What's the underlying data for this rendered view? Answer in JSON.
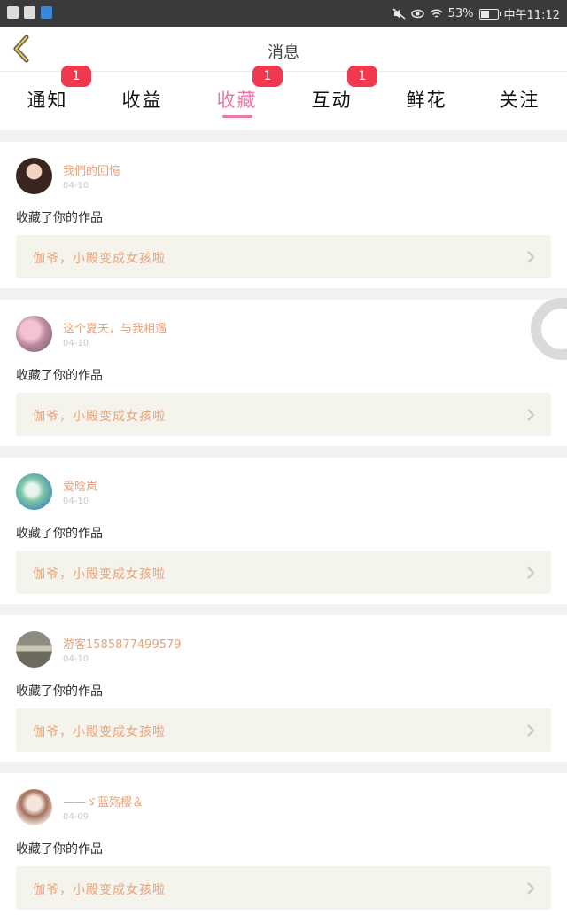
{
  "status_bar": {
    "battery": "53%",
    "time": "中午11:12",
    "icons": [
      "shopping-bag-icon",
      "shopping-bag-icon",
      "app-icon",
      "mute-icon",
      "eye-icon",
      "wifi-icon",
      "battery-icon"
    ]
  },
  "header": {
    "title": "消息",
    "back_icon": "chevron-left-icon"
  },
  "tabs": [
    {
      "label": "通知",
      "badge": "1"
    },
    {
      "label": "收益",
      "badge": ""
    },
    {
      "label": "收藏",
      "badge": "1",
      "active": true
    },
    {
      "label": "互动",
      "badge": "1"
    },
    {
      "label": "鲜花",
      "badge": ""
    },
    {
      "label": "关注",
      "badge": ""
    }
  ],
  "messages": [
    {
      "name": "我們的回憶",
      "date": "04-10",
      "action": "收藏了你的作品",
      "work": "伽爷，小殿变成女孩啦"
    },
    {
      "name": "这个夏天，与我相遇",
      "date": "04-10",
      "action": "收藏了你的作品",
      "work": "伽爷，小殿变成女孩啦"
    },
    {
      "name": "爱晗岚",
      "date": "04-10",
      "action": "收藏了你的作品",
      "work": "伽爷，小殿变成女孩啦"
    },
    {
      "name": "游客1585877499579",
      "date": "04-10",
      "action": "收藏了你的作品",
      "work": "伽爷，小殿变成女孩啦"
    },
    {
      "name": "——ゞ蓝殇樱＆",
      "date": "04-09",
      "action": "收藏了你的作品",
      "work": "伽爷，小殿变成女孩啦"
    }
  ],
  "colors": {
    "accent": "#e77aa8",
    "badge": "#f0394e",
    "name": "#e9a27b",
    "status_bar": "#3a3a3a"
  }
}
